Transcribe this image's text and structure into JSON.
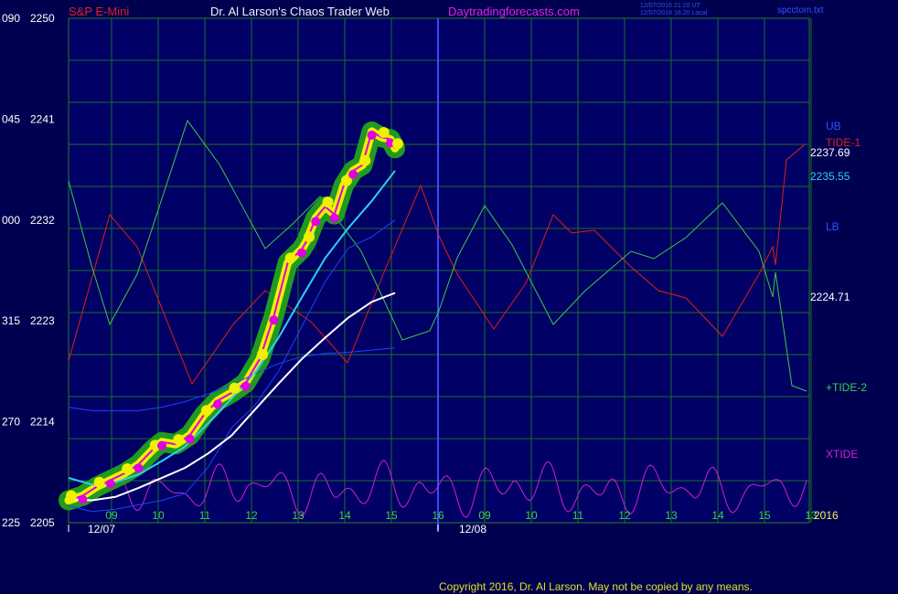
{
  "header": {
    "symbol": "S&P E-Mini",
    "title": "Dr. Al Larson's Chaos Trader Web",
    "site": "Daytradingforecasts.com",
    "timestamp_utc": "12/07/2016 21:20 UT",
    "timestamp_local": "12/07/2016 16:20 Local",
    "source_file": "spcctom.txt"
  },
  "footer": {
    "copyright": "Copyright 2016, Dr. Al Larson. May not be copied by any means.",
    "year": "2016"
  },
  "colors": {
    "background": "#000050",
    "plot_background": "#000066",
    "grid": "#1c6e2a",
    "price": "#e000e0",
    "tide1": "#e02010",
    "tide2": "#40c840",
    "xtide": "#d020d0",
    "ub": "#2040ff",
    "lb": "#2040ff",
    "ma_cyan": "#30d0f0",
    "ma_white": "#ffffff",
    "highlight_yellow": "#f0f000",
    "highlight_green": "#209a20"
  },
  "chart_data": {
    "type": "line",
    "title": "S&P E-Mini",
    "ylabels_left": [
      {
        "osc": "090",
        "price": "2250"
      },
      {
        "osc": "045",
        "price": "2241"
      },
      {
        "osc": "000",
        "price": "2232"
      },
      {
        "osc": "315",
        "price": "2223"
      },
      {
        "osc": "270",
        "price": "2214"
      },
      {
        "osc": "225",
        "price": "2205"
      }
    ],
    "ylim": [
      2205,
      2250
    ],
    "x_hour_ticks": [
      "09",
      "10",
      "11",
      "12",
      "13",
      "14",
      "15",
      "16",
      "09",
      "10",
      "11",
      "12",
      "13",
      "14",
      "15",
      "13"
    ],
    "date_labels": [
      "12/07",
      "12/08"
    ],
    "right_labels": {
      "ub": "UB",
      "tide1": "TIDE-1",
      "lb": "LB",
      "tide2": "+TIDE-2",
      "xtide": "XTIDE",
      "price_last": "2237.69",
      "ma_cyan_last": "2235.55",
      "ma_white_last": "2224.71"
    },
    "series": [
      {
        "name": "S&P E-Mini",
        "key": "price",
        "x": [
          0,
          0.3,
          0.6,
          0.9,
          1.2,
          1.5,
          1.8,
          2.0,
          2.3,
          2.6,
          2.9,
          3.2,
          3.5,
          3.8,
          4.1,
          4.4,
          4.7,
          5.0,
          5.1,
          5.3,
          5.5,
          5.7,
          5.9,
          6.1,
          6.3,
          6.5,
          6.7,
          6.9,
          7.0
        ],
        "y": [
          2207.0,
          2207.4,
          2208.2,
          2208.8,
          2209.4,
          2210.2,
          2211.5,
          2212.2,
          2212.0,
          2212.8,
          2214.6,
          2215.9,
          2216.6,
          2217.5,
          2219.6,
          2223.4,
          2228.2,
          2229.4,
          2230.1,
          2232.2,
          2233.2,
          2232.5,
          2235.1,
          2236.4,
          2236.9,
          2239.9,
          2239.4,
          2239.2,
          2238.4
        ]
      },
      {
        "name": "Cyan MA",
        "key": "ma_cyan",
        "x": [
          0,
          0.5,
          1.0,
          1.5,
          2.0,
          2.5,
          3.0,
          3.5,
          4.0,
          4.5,
          5.0,
          5.5,
          6.0,
          6.5,
          7.0
        ],
        "y": [
          2209.0,
          2208.4,
          2208.6,
          2209.3,
          2210.5,
          2211.8,
          2213.9,
          2216.1,
          2218.4,
          2221.5,
          2225.1,
          2228.6,
          2231.3,
          2233.7,
          2236.4
        ]
      },
      {
        "name": "White MA",
        "key": "ma_white",
        "x": [
          0,
          0.5,
          1.0,
          1.5,
          2.0,
          2.5,
          3.0,
          3.5,
          4.0,
          4.5,
          5.0,
          5.5,
          6.0,
          6.5,
          7.0
        ],
        "y": [
          2207.1,
          2207.0,
          2207.3,
          2208.1,
          2209.0,
          2209.9,
          2211.2,
          2212.8,
          2215.1,
          2217.4,
          2219.6,
          2221.5,
          2223.3,
          2224.7,
          2225.5
        ]
      },
      {
        "name": "UB",
        "key": "ub",
        "x": [
          0,
          0.5,
          1.0,
          1.5,
          2.0,
          2.5,
          3.0,
          3.5,
          4.0,
          4.5,
          5.0,
          5.5,
          6.0,
          6.5,
          7.0
        ],
        "y": [
          2206.5,
          2206.0,
          2206.2,
          2206.6,
          2207.0,
          2207.6,
          2210.0,
          2213.5,
          2215.5,
          2218.5,
          2222.5,
          2226.5,
          2229.5,
          2230.5,
          2232.0
        ]
      },
      {
        "name": "Blue band",
        "key": "lb",
        "x": [
          0,
          0.5,
          1.0,
          1.5,
          2.0,
          2.5,
          3.0,
          3.5,
          4.0,
          4.5,
          5.0,
          5.5,
          6.0,
          6.5,
          7.0
        ],
        "y": [
          2215.3,
          2215.0,
          2215.0,
          2215.0,
          2215.3,
          2215.8,
          2216.5,
          2217.3,
          2218.3,
          2219.2,
          2219.8,
          2220.1,
          2220.2,
          2220.4,
          2220.6
        ]
      }
    ]
  }
}
